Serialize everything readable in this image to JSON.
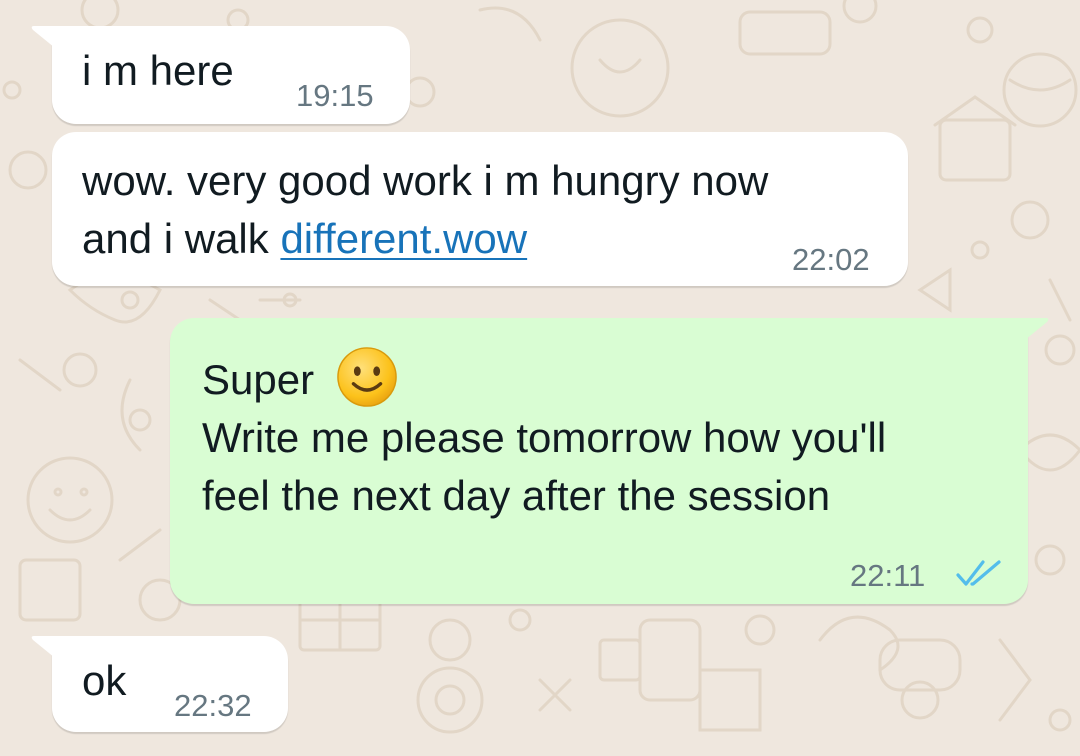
{
  "messages": [
    {
      "direction": "incoming",
      "text": "i m here",
      "time": "19:15"
    },
    {
      "direction": "incoming",
      "text_lines": [
        "wow. very good work  i m hungry now",
        "and i walk "
      ],
      "link_text": "different.wow",
      "time": "22:02"
    },
    {
      "direction": "outgoing",
      "text_lines": [
        "Super",
        "Write me please tomorrow how you'll",
        "feel the next day after the session"
      ],
      "emoji": "slightly-smiling-face-icon",
      "time": "22:11",
      "status": "read-double-tick-icon"
    },
    {
      "direction": "incoming",
      "text": "ok",
      "time": "22:32"
    }
  ],
  "colors": {
    "wallpaper": "#efe7de",
    "incoming_bubble": "#ffffff",
    "outgoing_bubble": "#d9fdd3",
    "link": "#1873b9",
    "read_ticks": "#53bdeb",
    "timestamp": "#667781"
  }
}
